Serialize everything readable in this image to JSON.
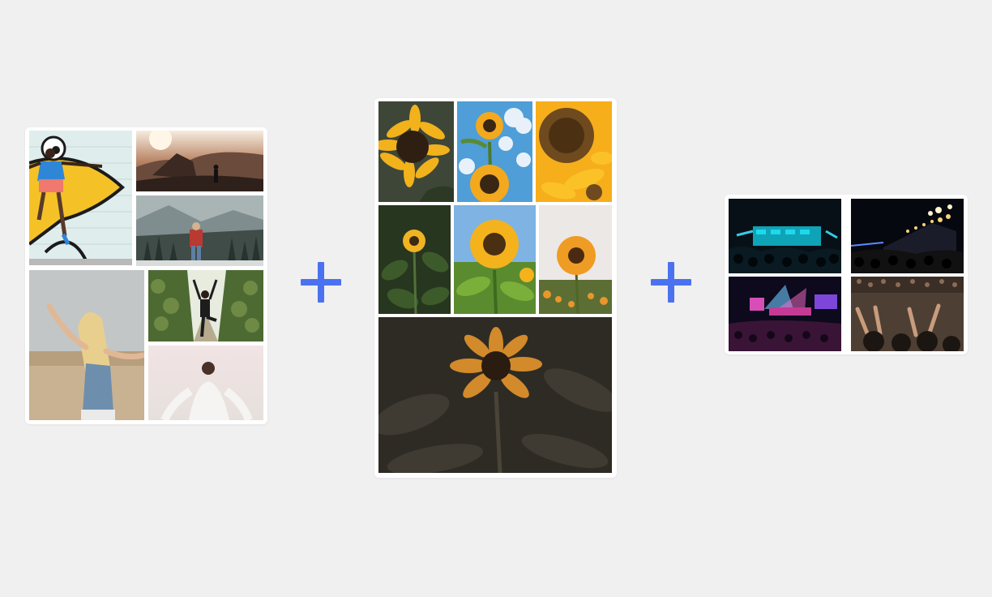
{
  "colors": {
    "background": "#f0f0f0",
    "card": "#ffffff",
    "plus": "#4a72f0"
  },
  "icons": [
    "plus-icon",
    "plus-icon"
  ],
  "collages": [
    {
      "name": "people-collage",
      "photos": [
        "graffiti-wall-person",
        "cliff-sunset-hiker",
        "mountain-forest-hiker",
        "field-woman-arms-spread",
        "vineyard-yoga-woman",
        "woman-white-field"
      ]
    },
    {
      "name": "sunflower-collage",
      "photos": [
        "sunflower-closeup",
        "sunflowers-blue-sky",
        "sunflower-petals-macro",
        "sunflower-green-leaves",
        "sunflower-field-sky",
        "sunflower-field-dusk",
        "sunflower-dark-moody"
      ]
    },
    {
      "name": "concert-collage",
      "photos": [
        "concert-blue-stage",
        "concert-fireworks",
        "concert-pink-screens",
        "concert-crowd-hands"
      ]
    }
  ]
}
